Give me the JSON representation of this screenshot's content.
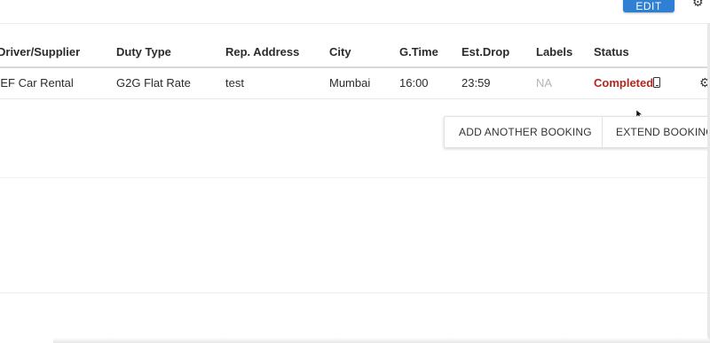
{
  "toolbar": {
    "edit_label": "EDIT"
  },
  "table": {
    "columns": [
      "Driver/Supplier",
      "Duty Type",
      "Rep. Address",
      "City",
      "G.Time",
      "Est.Drop",
      "Labels",
      "Status"
    ],
    "rows": [
      {
        "driver": "DEF Car Rental",
        "duty_type": "G2G Flat Rate",
        "rep_address": "test",
        "city": "Mumbai",
        "g_time": "16:00",
        "est_drop": "23:59",
        "labels": "NA",
        "status": "Completed"
      }
    ]
  },
  "actions": {
    "add_booking": "ADD ANOTHER BOOKING",
    "extend_booking": "EXTEND BOOKING"
  },
  "icons": {
    "gear": "gear-icon",
    "phone": "mobile-phone-icon",
    "cursor": "mouse-cursor-icon"
  },
  "colors": {
    "primary": "#2f7fd3",
    "status_completed": "#b3261e",
    "na_text": "#b5b5b5"
  }
}
